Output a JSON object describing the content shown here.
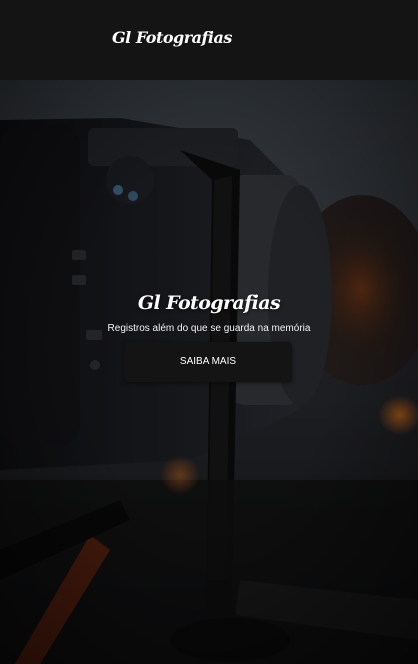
{
  "header": {
    "logo_text": "Gl Fotografias"
  },
  "hero": {
    "title": "Gl Fotografias",
    "subtitle": "Registros além do que se guarda na memória",
    "cta_label": "SAIBA MAIS"
  },
  "colors": {
    "header_background": "#141414",
    "button_background": "#141414",
    "text": "#ffffff"
  }
}
